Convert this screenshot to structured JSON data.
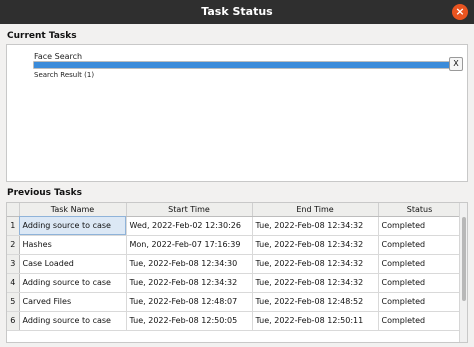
{
  "window": {
    "title": "Task Status",
    "close_label": "×"
  },
  "current": {
    "heading": "Current Tasks",
    "task_name": "Face Search",
    "progress": 1.0,
    "result": "Search Result (1)",
    "cancel_label": "X"
  },
  "previous": {
    "heading": "Previous Tasks",
    "columns": [
      "Task Name",
      "Start Time",
      "End Time",
      "Status"
    ],
    "rows": [
      {
        "num": "1",
        "task": "Adding source to case",
        "start": "Wed, 2022-Feb-02 12:30:26",
        "end": "Tue, 2022-Feb-08 12:34:32",
        "status": "Completed"
      },
      {
        "num": "2",
        "task": "Hashes",
        "start": "Mon, 2022-Feb-07 17:16:39",
        "end": "Tue, 2022-Feb-08 12:34:32",
        "status": "Completed"
      },
      {
        "num": "3",
        "task": "Case Loaded",
        "start": "Tue, 2022-Feb-08 12:34:30",
        "end": "Tue, 2022-Feb-08 12:34:32",
        "status": "Completed"
      },
      {
        "num": "4",
        "task": "Adding source to case",
        "start": "Tue, 2022-Feb-08 12:34:32",
        "end": "Tue, 2022-Feb-08 12:34:32",
        "status": "Completed"
      },
      {
        "num": "5",
        "task": "Carved Files",
        "start": "Tue, 2022-Feb-08 12:48:07",
        "end": "Tue, 2022-Feb-08 12:48:52",
        "status": "Completed"
      },
      {
        "num": "6",
        "task": "Adding source to case",
        "start": "Tue, 2022-Feb-08 12:50:05",
        "end": "Tue, 2022-Feb-08 12:50:11",
        "status": "Completed"
      }
    ]
  }
}
